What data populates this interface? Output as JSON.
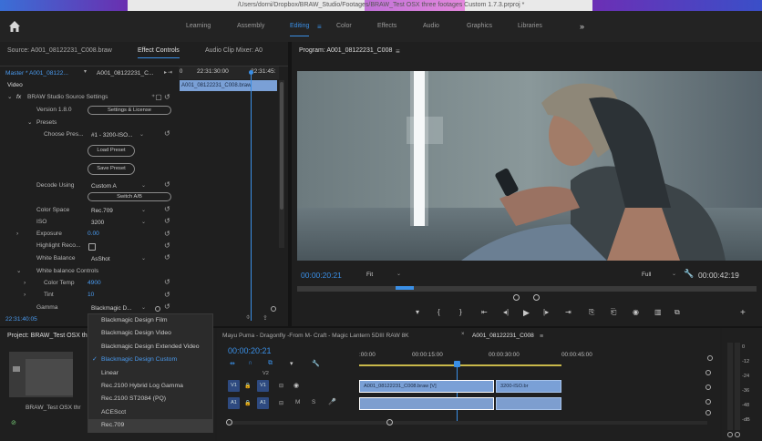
{
  "window": {
    "title": "/Users/dorni/Dropbox/BRAW_Studio/Footages/BRAW_Test OSX three footages Custom 1.7.3.prproj *"
  },
  "workspaces": {
    "items": [
      "Learning",
      "Assembly",
      "Editing",
      "Color",
      "Effects",
      "Audio",
      "Graphics",
      "Libraries"
    ],
    "active": "Editing",
    "more": "»"
  },
  "effect_controls": {
    "tab_source": "Source: A001_08122231_C008.braw",
    "tab_effect_controls": "Effect Controls",
    "tab_audio_mixer": "Audio Clip Mixer: A0",
    "master_label": "Master * A001_08122...",
    "clip_label": "A001_08122231_C...",
    "ruler_tc1": "22:31:30:00",
    "ruler_tc2": "22:31:45:",
    "clip_block": "A001_08122231_C008.braw",
    "video_header": "Video",
    "fx_label": "fx",
    "plugin_name": "BRAW Studio Source Settings",
    "version": "Version 1.8.0",
    "settings_license": "Settings & License",
    "presets": "Presets",
    "choose_preset": "Choose Pres...",
    "preset_value": "#1 - 3200-ISO...",
    "load_preset": "Load Preset",
    "save_preset": "Save Preset",
    "decode_using": "Decode Using",
    "decode_value": "Custom A",
    "switch_ab": "Switch A/B",
    "color_space": "Color Space",
    "color_space_value": "Rec.709",
    "iso": "ISO",
    "iso_value": "3200",
    "exposure": "Exposure",
    "exposure_value": "0.00",
    "highlight_recovery": "Highlight Reco...",
    "white_balance": "White Balance",
    "white_balance_value": "AsShot",
    "white_balance_controls": "White balance Controls",
    "color_temp": "Color Temp",
    "color_temp_value": "4900",
    "tint": "Tint",
    "tint_value": "10",
    "gamma": "Gamma",
    "gamma_value": "Blackmagic D...",
    "timecode": "22:31:40:05"
  },
  "gamma_menu": {
    "items": [
      {
        "label": "Blackmagic Design Film",
        "checked": false
      },
      {
        "label": "Blackmagic Design Video",
        "checked": false
      },
      {
        "label": "Blackmagic Design Extended Video",
        "checked": false
      },
      {
        "label": "Blackmagic Design Custom",
        "checked": true
      },
      {
        "label": "Linear",
        "checked": false
      },
      {
        "label": "Rec.2100 Hybrid Log Gamma",
        "checked": false
      },
      {
        "label": "Rec.2100 ST2084 (PQ)",
        "checked": false
      },
      {
        "label": "ACEScct",
        "checked": false
      },
      {
        "label": "Rec.709",
        "checked": false
      }
    ],
    "check_mark": "✓"
  },
  "program": {
    "title": "Program: A001_08122231_C008",
    "timecode": "00:00:20:21",
    "fit": "Fit",
    "quality": "Full",
    "duration": "00:00:42:19"
  },
  "project": {
    "title": "Project: BRAW_Test OSX thr",
    "item": "BRAW_Test OSX thr"
  },
  "timeline": {
    "tabs": [
      "Mayu Puma - Dragonfly -From M- Craft - Magic Lantern 5DIII RAW 8K",
      "A001_08122231_C008"
    ],
    "timecode": "00:00:20:21",
    "ruler": [
      ":00:00",
      "00:00:15:00",
      "00:00:30:00",
      "00:00:45:00"
    ],
    "tracks": {
      "v2": "V2",
      "v1_src": "V1",
      "v1": "V1",
      "a1_src": "A1",
      "a1": "A1",
      "m": "M",
      "s": "S"
    },
    "clips": {
      "v1_main": "A001_08122231_C008.braw [V]",
      "v1_second": "3200-ISO.br"
    }
  },
  "meter": {
    "labels": [
      "0",
      "-12",
      "-24",
      "-36",
      "-48",
      "-dB"
    ]
  },
  "colors": {
    "accent": "#3a8fe6",
    "clip_video": "#7aa0d6",
    "track_button": "#2e4a80"
  }
}
